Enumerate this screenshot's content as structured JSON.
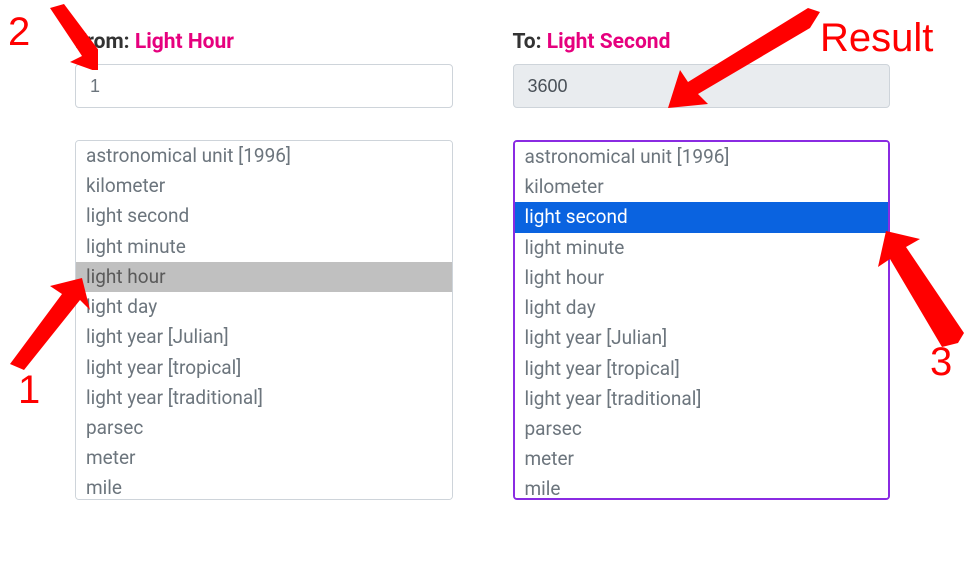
{
  "from": {
    "label_prefix": "From: ",
    "selected_unit": "Light Hour",
    "value": "1",
    "selected_index": 4
  },
  "to": {
    "label_prefix": "To: ",
    "selected_unit": "Light Second",
    "value": "3600",
    "selected_index": 2
  },
  "units": [
    "astronomical unit [1996]",
    "kilometer",
    "light second",
    "light minute",
    "light hour",
    "light day",
    "light year [Julian]",
    "light year [tropical]",
    "light year [traditional]",
    "parsec",
    "meter",
    "mile"
  ],
  "annotations": {
    "n1": "1",
    "n2": "2",
    "n3": "3",
    "result": "Result"
  },
  "colors": {
    "accent": "#e6007e",
    "selection_blue": "#0a63e0",
    "annotation": "#ff0000",
    "focus_border": "#8a2be2"
  }
}
